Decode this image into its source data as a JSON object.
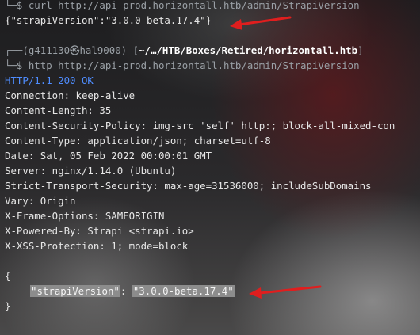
{
  "terminal": {
    "cmd1": {
      "prefix": "└─$ ",
      "command": "curl http://api-prod.horizontall.htb/admin/StrapiVersion"
    },
    "json1": "{\"strapiVersion\":\"3.0.0-beta.17.4\"}",
    "prompt": {
      "open": "┌──(",
      "user": "g411130",
      "at": "㉿",
      "host": "hal9000",
      "mid": ")-[",
      "path": "~/…/HTB/Boxes/Retired/horizontall.htb",
      "close": "]"
    },
    "cmd2": {
      "prefix": "└─$ ",
      "command": "http http://api-prod.horizontall.htb/admin/StrapiVersion"
    },
    "headers": [
      "HTTP/1.1 200 OK",
      "Connection: keep-alive",
      "Content-Length: 35",
      "Content-Security-Policy: img-src 'self' http:; block-all-mixed-con",
      "Content-Type: application/json; charset=utf-8",
      "Date: Sat, 05 Feb 2022 00:00:01 GMT",
      "Server: nginx/1.14.0 (Ubuntu)",
      "Strict-Transport-Security: max-age=31536000; includeSubDomains",
      "Vary: Origin",
      "X-Frame-Options: SAMEORIGIN",
      "X-Powered-By: Strapi <strapi.io>",
      "X-XSS-Protection: 1; mode=block"
    ],
    "json2": {
      "open": "{",
      "key": "\"strapiVersion\"",
      "colon": ":",
      "value": "\"3.0.0-beta.17.4\"",
      "close": "}"
    },
    "arrow_color": "#e01e1e"
  }
}
